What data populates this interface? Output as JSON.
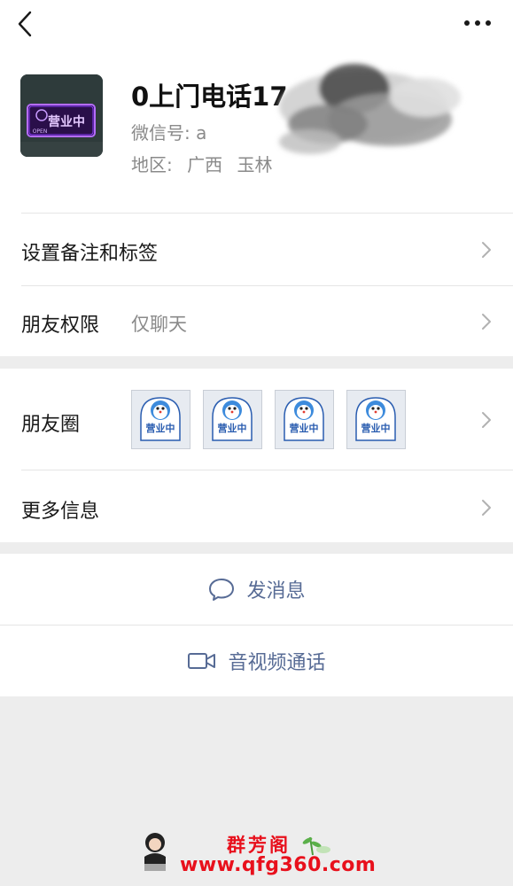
{
  "topbar": {
    "back_icon": "chevron-left-icon",
    "more_icon": "ellipsis-icon"
  },
  "profile": {
    "name": "0上门电话17",
    "wechat_id_label": "微信号:",
    "wechat_id_value": "a",
    "region_label": "地区:",
    "region_province": "广西",
    "region_city": "玉林",
    "avatar_sign_text": "营业中",
    "avatar_sign_small": "OPEN"
  },
  "rows": {
    "remark": {
      "label": "设置备注和标签"
    },
    "permission": {
      "label": "朋友权限",
      "value": "仅聊天"
    },
    "moments": {
      "label": "朋友圈",
      "thumb_text": "营业中"
    },
    "more_info": {
      "label": "更多信息"
    }
  },
  "actions": {
    "message": {
      "label": "发消息",
      "icon": "chat-bubble-icon"
    },
    "video_call": {
      "label": "音视频通话",
      "icon": "video-camera-icon"
    }
  },
  "watermark": {
    "site_name": "群芳阁",
    "url": "www.qfg360.com"
  },
  "colors": {
    "link_blue": "#576b95",
    "watermark_red": "#e8101c",
    "background": "#ededed"
  }
}
